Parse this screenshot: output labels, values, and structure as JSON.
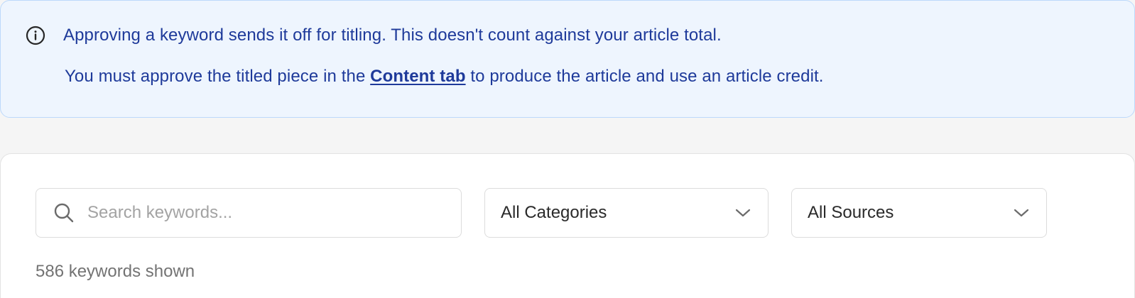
{
  "notice": {
    "icon": "info-icon",
    "line1": "Approving a keyword sends it off for titling. This doesn't count against your article total.",
    "line2_before": "You must approve the titled piece in the ",
    "line2_link": "Content tab",
    "line2_after": " to produce the article and use an article credit.",
    "colors": {
      "background": "#eef5fe",
      "border": "#bcd9fb",
      "text": "#1e3a9a"
    }
  },
  "filters": {
    "search": {
      "icon": "search-icon",
      "placeholder": "Search keywords...",
      "value": ""
    },
    "category_select": {
      "selected": "All Categories",
      "icon": "chevron-down-icon"
    },
    "source_select": {
      "selected": "All Sources",
      "icon": "chevron-down-icon"
    }
  },
  "results": {
    "count_text": "586 keywords shown"
  }
}
